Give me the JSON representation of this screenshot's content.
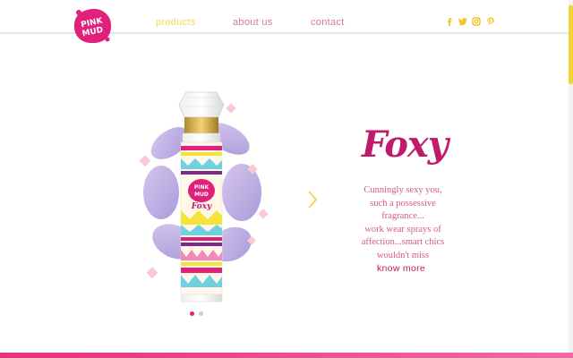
{
  "brand": {
    "logo_text_line1": "PINK",
    "logo_text_line2": "MUD"
  },
  "nav": {
    "items": [
      {
        "label": "products",
        "color": "#f0dc55"
      },
      {
        "label": "about us",
        "color": "#d27aa0"
      },
      {
        "label": "contact",
        "color": "#d27aa0"
      }
    ]
  },
  "social": [
    {
      "icon": "facebook-icon"
    },
    {
      "icon": "twitter-icon"
    },
    {
      "icon": "instagram-icon"
    },
    {
      "icon": "pinterest-icon"
    }
  ],
  "product": {
    "name": "Foxy",
    "label_brand_line1": "PINK",
    "label_brand_line2": "MUD",
    "label_name": "Foxy",
    "description": [
      "Cunningly sexy you,",
      "such a possessive",
      "fragrance...",
      "work wear sprays of",
      "affection...smart chics",
      "wouldn't miss"
    ],
    "cta": "know more"
  },
  "carousel": {
    "active_index": 0,
    "count": 2,
    "next_icon": "chevron-right-icon"
  },
  "colors": {
    "accent": "#c21a6a",
    "yellow": "#f3d233",
    "pink_text": "#d27aa0",
    "footer": "#e8317a"
  }
}
